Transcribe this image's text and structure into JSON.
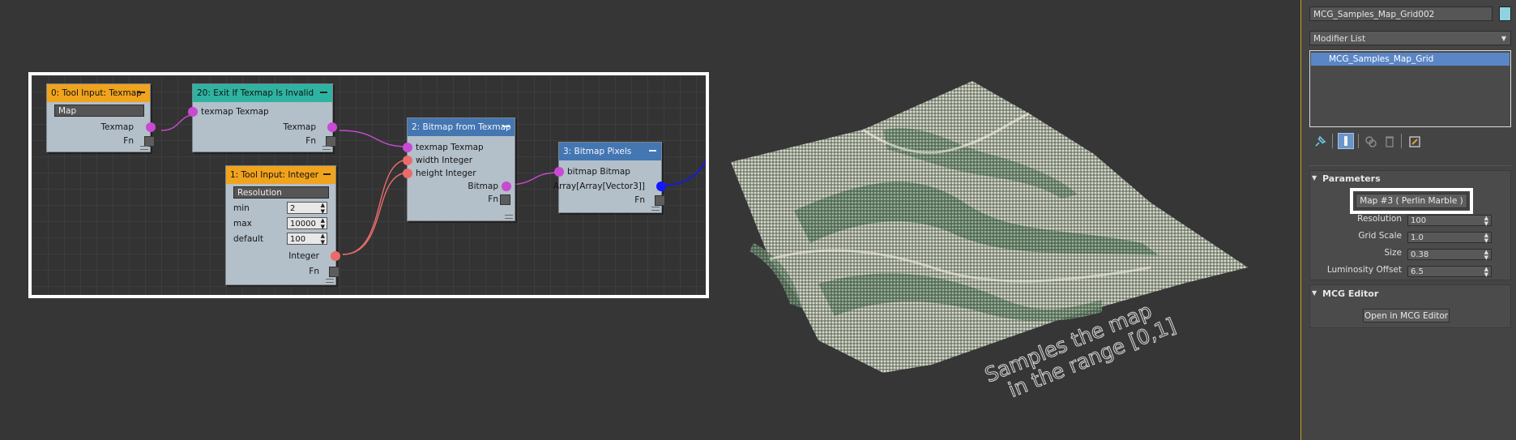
{
  "graph": {
    "nodes": {
      "tool_input_texmap": {
        "title": "0: Tool Input: Texmap",
        "field": "Map",
        "out": "Texmap",
        "fn": "Fn"
      },
      "exit_if_invalid": {
        "title": "20: Exit If Texmap Is Invalid",
        "in": "texmap Texmap",
        "out": "Texmap",
        "fn": "Fn"
      },
      "tool_input_integer": {
        "title": "1: Tool Input: Integer",
        "field": "Resolution",
        "min_label": "min",
        "min_value": "2",
        "max_label": "max",
        "max_value": "10000",
        "default_label": "default",
        "default_value": "100",
        "out": "Integer",
        "fn": "Fn"
      },
      "bitmap_from_texmap": {
        "title": "2: Bitmap from Texmap",
        "in1": "texmap Texmap",
        "in2": "width Integer",
        "in3": "height Integer",
        "out": "Bitmap",
        "fn": "Fn"
      },
      "bitmap_pixels": {
        "title": "3: Bitmap Pixels",
        "in": "bitmap Bitmap",
        "out": "Array[Array[Vector3]]",
        "fn": "Fn"
      }
    }
  },
  "viewport": {
    "annotation_line1": "Samples the map",
    "annotation_line2": "in the range [0,1]"
  },
  "panel": {
    "object_name": "MCG_Samples_Map_Grid002",
    "object_color": "#8ed3e0",
    "modifier_list": "Modifier List",
    "stack_items": [
      "MCG_Samples_Map_Grid"
    ],
    "toolbar_icons": [
      "pin-stack-icon",
      "show-end-result-icon",
      "make-unique-icon",
      "remove-modifier-icon",
      "configure-modifier-sets-icon"
    ],
    "parameters": {
      "title": "Parameters",
      "map_button": "Map #3 ( Perlin Marble )",
      "fields": [
        {
          "label": "Resolution",
          "value": "100"
        },
        {
          "label": "Grid Scale",
          "value": "1.0"
        },
        {
          "label": "Size",
          "value": "0.38"
        },
        {
          "label": "Luminosity Offset",
          "value": "6.5"
        }
      ]
    },
    "mcg_editor": {
      "title": "MCG Editor",
      "button": "Open in MCG Editor"
    }
  },
  "colors": {
    "background": "#363636",
    "header_orange": "#f0a31c",
    "header_teal": "#2fb3a1",
    "header_blue": "#4476b2",
    "wire_texmap": "#c94ad2",
    "wire_integer": "#ea6b6b",
    "selection": "#5b86c5"
  }
}
